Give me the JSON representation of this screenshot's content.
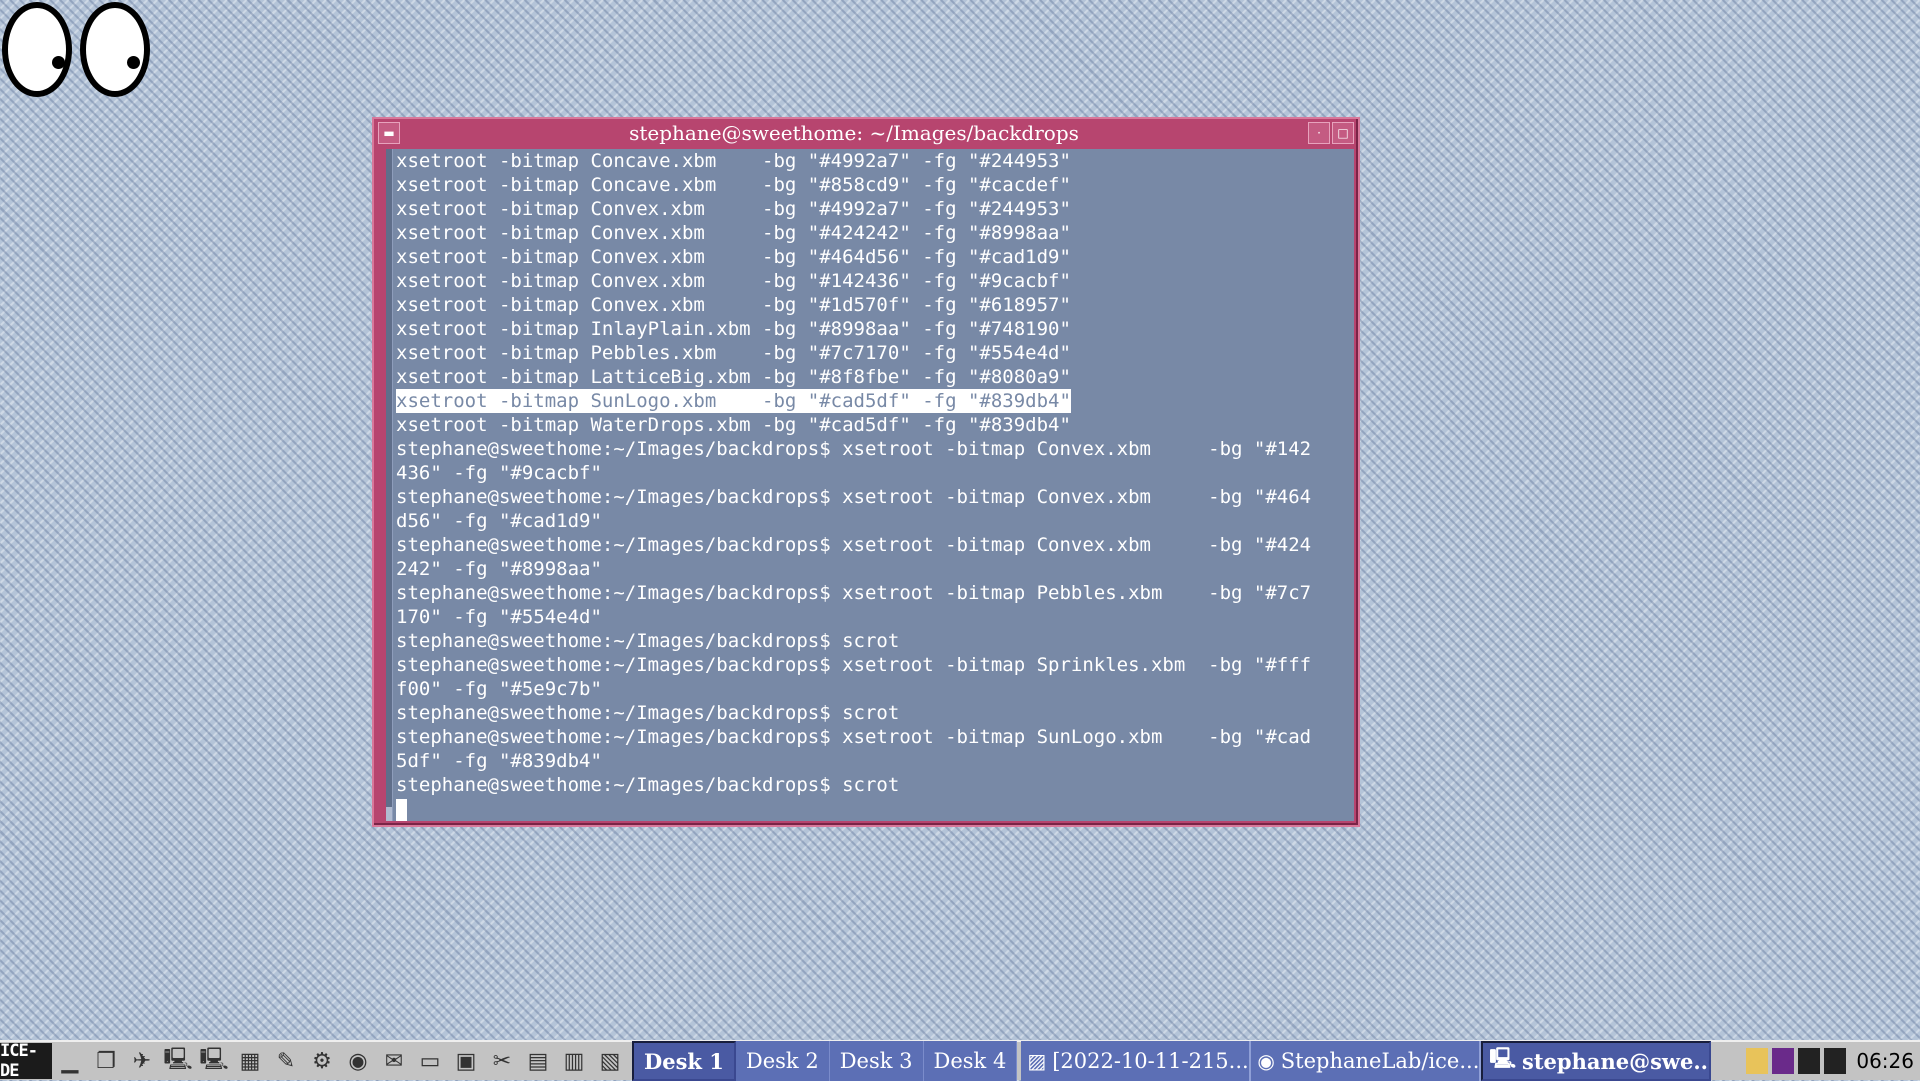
{
  "window": {
    "title": "stephane@sweethome: ~/Images/backdrops"
  },
  "terminal": {
    "lines": [
      "xsetroot -bitmap Concave.xbm    -bg \"#4992a7\" -fg \"#244953\"",
      "xsetroot -bitmap Concave.xbm    -bg \"#858cd9\" -fg \"#cacdef\"",
      "xsetroot -bitmap Convex.xbm     -bg \"#4992a7\" -fg \"#244953\"",
      "xsetroot -bitmap Convex.xbm     -bg \"#424242\" -fg \"#8998aa\"",
      "xsetroot -bitmap Convex.xbm     -bg \"#464d56\" -fg \"#cad1d9\"",
      "xsetroot -bitmap Convex.xbm     -bg \"#142436\" -fg \"#9cacbf\"",
      "xsetroot -bitmap Convex.xbm     -bg \"#1d570f\" -fg \"#618957\"",
      "xsetroot -bitmap InlayPlain.xbm -bg \"#8998aa\" -fg \"#748190\"",
      "xsetroot -bitmap Pebbles.xbm    -bg \"#7c7170\" -fg \"#554e4d\"",
      "xsetroot -bitmap LatticeBig.xbm -bg \"#8f8fbe\" -fg \"#8080a9\"",
      "xsetroot -bitmap SunLogo.xbm    -bg \"#cad5df\" -fg \"#839db4\"",
      "xsetroot -bitmap WaterDrops.xbm -bg \"#cad5df\" -fg \"#839db4\"",
      "stephane@sweethome:~/Images/backdrops$ xsetroot -bitmap Convex.xbm     -bg \"#142",
      "436\" -fg \"#9cacbf\"",
      "stephane@sweethome:~/Images/backdrops$ xsetroot -bitmap Convex.xbm     -bg \"#464",
      "d56\" -fg \"#cad1d9\"",
      "stephane@sweethome:~/Images/backdrops$ xsetroot -bitmap Convex.xbm     -bg \"#424",
      "242\" -fg \"#8998aa\"",
      "stephane@sweethome:~/Images/backdrops$ xsetroot -bitmap Pebbles.xbm    -bg \"#7c7",
      "170\" -fg \"#554e4d\"",
      "stephane@sweethome:~/Images/backdrops$ scrot",
      "stephane@sweethome:~/Images/backdrops$ xsetroot -bitmap Sprinkles.xbm  -bg \"#fff",
      "f00\" -fg \"#5e9c7b\"",
      "stephane@sweethome:~/Images/backdrops$ scrot",
      "stephane@sweethome:~/Images/backdrops$ xsetroot -bitmap SunLogo.xbm    -bg \"#cad",
      "5df\" -fg \"#839db4\"",
      "stephane@sweethome:~/Images/backdrops$ scrot"
    ],
    "selected_line_index": 10
  },
  "taskbar": {
    "start_label": "ICE-DE",
    "quick_launch": [
      "show-desktop-icon",
      "window-list-icon",
      "run-icon",
      "terminal-icon",
      "terminal-2-icon",
      "calculator-icon",
      "editor-icon",
      "system-icon",
      "firefox-icon",
      "thunderbird-icon",
      "folder-icon",
      "image-viewer-icon",
      "gimp-icon",
      "writer-icon",
      "calc-icon",
      "impress-icon"
    ],
    "desks": [
      "Desk 1",
      "Desk 2",
      "Desk 3",
      "Desk 4"
    ],
    "active_desk": 0,
    "tasks": [
      {
        "label": "[2022-10-11-215...",
        "icon": "screenshot-icon"
      },
      {
        "label": "StephaneLab/ice...",
        "icon": "firefox-icon"
      },
      {
        "label": "stephane@swe...",
        "icon": "terminal-icon"
      }
    ],
    "active_task": 2,
    "clock": "06:26"
  },
  "colors": {
    "window_frame": "#b7456f",
    "terminal_bg": "#7889a6",
    "taskbar_active": "#4a5aa3"
  }
}
